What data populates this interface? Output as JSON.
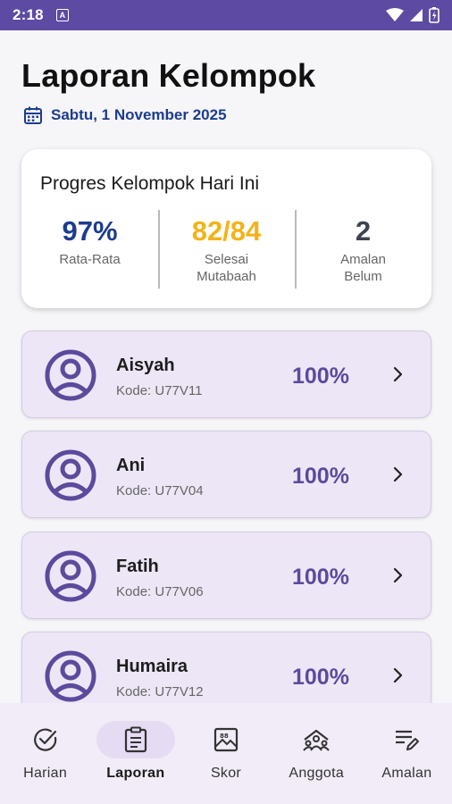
{
  "status": {
    "time": "2:18",
    "notif_icon_letter": "A"
  },
  "header": {
    "title": "Laporan Kelompok",
    "date": "Sabtu, 1 November 2025"
  },
  "summary": {
    "title": "Progres Kelompok Hari Ini",
    "stats": [
      {
        "value": "97%",
        "label": "Rata-Rata",
        "color": "#1c3c8f"
      },
      {
        "value": "82/84",
        "label": "Selesai\nMutabaah",
        "color": "#f4b21a"
      },
      {
        "value": "2",
        "label": "Amalan\nBelum",
        "color": "#3f4350"
      }
    ]
  },
  "members": [
    {
      "name": "Aisyah",
      "code": "Kode: U77V11",
      "percent": "100%"
    },
    {
      "name": "Ani",
      "code": "Kode: U77V04",
      "percent": "100%"
    },
    {
      "name": "Fatih",
      "code": "Kode: U77V06",
      "percent": "100%"
    },
    {
      "name": "Humaira",
      "code": "Kode: U77V12",
      "percent": "100%"
    }
  ],
  "nav": {
    "items": [
      {
        "label": "Harian",
        "icon": "check-circle-icon"
      },
      {
        "label": "Laporan",
        "icon": "clipboard-icon",
        "active": true
      },
      {
        "label": "Skor",
        "icon": "scoreboard-icon"
      },
      {
        "label": "Anggota",
        "icon": "group-icon"
      },
      {
        "label": "Amalan",
        "icon": "list-edit-icon"
      }
    ]
  },
  "colors": {
    "accent": "#5d4aa3",
    "card_bg": "#ede6f6",
    "date_blue": "#1c3c8f",
    "gold": "#f4b21a"
  }
}
